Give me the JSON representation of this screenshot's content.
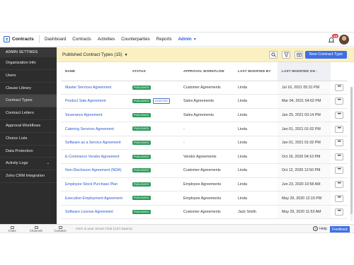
{
  "app": {
    "name": "Contracts"
  },
  "topnav": {
    "items": [
      "Dashboard",
      "Contracts",
      "Activities",
      "Counterparties",
      "Reports"
    ],
    "active": "Admin",
    "notification_count": "13"
  },
  "sidebar": {
    "header": "ADMIN SETTINGS",
    "items": [
      "Organization Info",
      "Users",
      "Clause Library",
      "Contract Types",
      "Contract Letters",
      "Approval Workflows",
      "Choice Lists",
      "Data Protection",
      "Activity Logs",
      "Zoho CRM Integration"
    ],
    "active_index": 3
  },
  "toolbar": {
    "view_title": "Published Contract Types (15)",
    "new_button": "New Contract Type"
  },
  "table": {
    "columns": [
      "NAME",
      "STATUS",
      "APPROVAL WORKFLOW",
      "LAST MODIFIED BY",
      "LAST MODIFIED ON"
    ],
    "sort_indicator": "↓",
    "rows": [
      {
        "name": "Master Services Agreement",
        "status": "PUBLISHED",
        "modified": "",
        "workflow": "Customer Agreements",
        "by": "Linda",
        "on": "Jul 16, 2021 05:31 PM"
      },
      {
        "name": "Product Sale Agreement",
        "status": "PUBLISHED",
        "modified": "MODIFIED",
        "workflow": "Sales Agreements",
        "by": "Linda",
        "on": "Mar 04, 2021 04:02 PM"
      },
      {
        "name": "Severance Agreement",
        "status": "PUBLISHED",
        "modified": "",
        "workflow": "Sales Agreements",
        "by": "Linda",
        "on": "Jan 25, 2021 03:14 PM"
      },
      {
        "name": "Catering Services Agreement",
        "status": "PUBLISHED",
        "modified": "",
        "workflow": "-",
        "by": "Linda",
        "on": "Jan 01, 2021 01:02 PM"
      },
      {
        "name": "Software as a Service Agreement",
        "status": "PUBLISHED",
        "modified": "",
        "workflow": "-",
        "by": "Linda",
        "on": "Jan 01, 2021 01:02 PM"
      },
      {
        "name": "E-Commerce Vendor Agreement",
        "status": "PUBLISHED",
        "modified": "",
        "workflow": "Vendor Agreements",
        "by": "Linda",
        "on": "Oct 16, 2020 04:10 PM"
      },
      {
        "name": "Non-Disclosure Agreement (NDA)",
        "status": "PUBLISHED",
        "modified": "",
        "workflow": "Customer Agreements",
        "by": "Linda",
        "on": "Oct 12, 2020 12:50 PM"
      },
      {
        "name": "Employee Stock Purchase Plan",
        "status": "PUBLISHED",
        "modified": "",
        "workflow": "Employee Agreements",
        "by": "Linda",
        "on": "Jun 23, 2020 10:58 AM"
      },
      {
        "name": "Executive Employment Agreement",
        "status": "PUBLISHED",
        "modified": "",
        "workflow": "Employee Agreements",
        "by": "Linda",
        "on": "May 29, 2020 12:15 PM"
      },
      {
        "name": "Software License Agreement",
        "status": "PUBLISHED",
        "modified": "",
        "workflow": "Customer Agreements",
        "by": "Jack Smith",
        "on": "May 29, 2020 11:53 AM"
      }
    ]
  },
  "bottombar": {
    "items": [
      "Chats",
      "Channels",
      "Contacts"
    ],
    "chat_placeholder": "Here is your Smart Chat (Ctrl+Space)",
    "help": "Help",
    "feedback": "Feedback"
  }
}
